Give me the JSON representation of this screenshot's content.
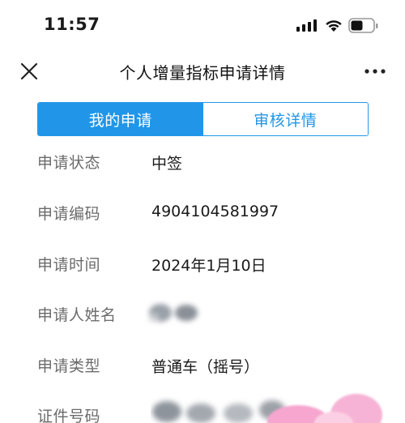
{
  "status_bar": {
    "time": "11:57"
  },
  "nav": {
    "title": "个人增量指标申请详情"
  },
  "tabs": [
    {
      "label": "我的申请",
      "active": true
    },
    {
      "label": "审核详情",
      "active": false
    }
  ],
  "details": {
    "status": {
      "label": "申请状态",
      "value": "中签"
    },
    "code": {
      "label": "申请编码",
      "value": "4904104581997"
    },
    "time": {
      "label": "申请时间",
      "value": "2024年1月10日"
    },
    "name": {
      "label": "申请人姓名",
      "value": ""
    },
    "type": {
      "label": "申请类型",
      "value": "普通车（摇号）"
    },
    "id": {
      "label": "证件号码",
      "value": ""
    }
  },
  "colors": {
    "accent": "#2196e8",
    "label_gray": "#6b6b6b",
    "sticker_pink": "#f6a6cf"
  },
  "icons": [
    "close-icon",
    "more-icon",
    "signal-icon",
    "wifi-icon",
    "battery-icon"
  ]
}
